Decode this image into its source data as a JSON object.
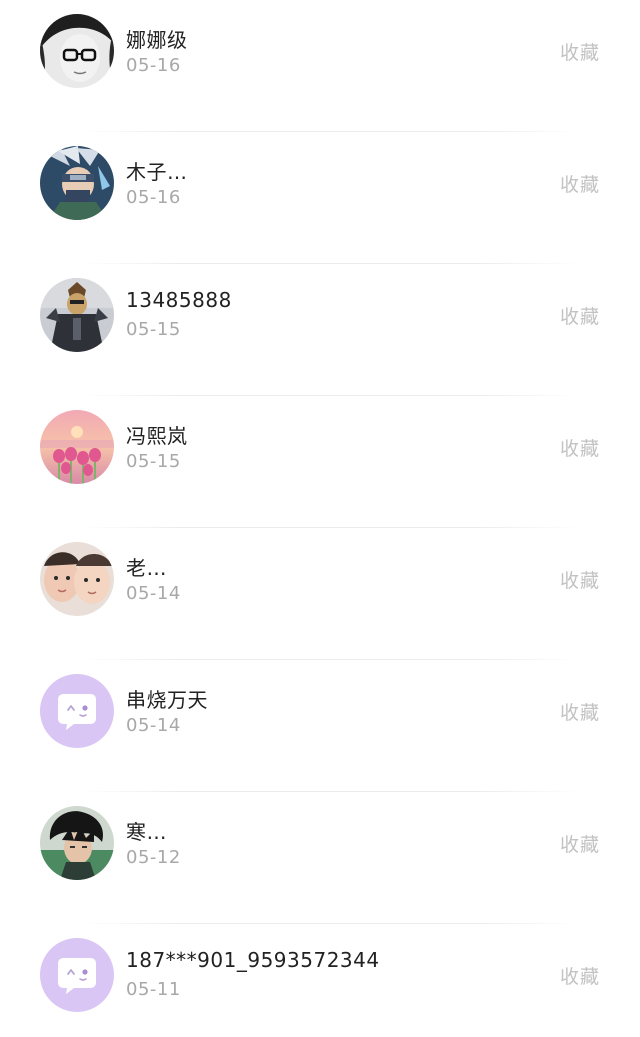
{
  "fav_label": "收藏",
  "items": [
    {
      "name": "娜娜级",
      "date": "05-16",
      "avatar": "bw-glasses-girl-avatar"
    },
    {
      "name": "木子…",
      "date": "05-16",
      "avatar": "anime-ninja-avatar"
    },
    {
      "name": "13485888",
      "date": "05-15",
      "avatar": "masked-figure-avatar"
    },
    {
      "name": "冯熙岚",
      "date": "05-15",
      "avatar": "tulips-sunset-avatar"
    },
    {
      "name": "老…",
      "date": "05-14",
      "avatar": "children-faces-avatar"
    },
    {
      "name": "串烧万天",
      "date": "05-14",
      "avatar": "default-chat-bubble-avatar"
    },
    {
      "name": "寒…",
      "date": "05-12",
      "avatar": "anime-boy-avatar"
    },
    {
      "name": "187***901_9593572344",
      "date": "05-11",
      "avatar": "default-chat-bubble-avatar"
    }
  ],
  "colors": {
    "default_avatar_bg": "#d9c6f5",
    "fav_text": "#c2c2c2",
    "date_text": "#a8a8a8"
  }
}
